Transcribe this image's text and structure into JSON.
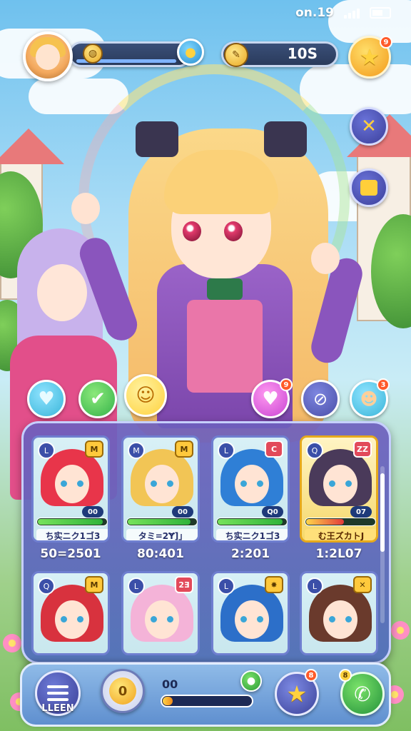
{
  "status_bar": {
    "time": "on.19"
  },
  "hud": {
    "avatar": "player-avatar",
    "left_bar_icon": "coin-icon",
    "left_bar_button_icon": "chick-icon",
    "currency_icon": "feather-icon",
    "currency_value": "10S",
    "star_button_badge": "9"
  },
  "side_buttons": [
    {
      "icon": "crossed-swords-icon"
    },
    {
      "icon": "bag-icon"
    }
  ],
  "quick_actions": [
    {
      "icon": "heart-icon",
      "color": "#3ab6d9"
    },
    {
      "icon": "check-icon",
      "color": "#35b34a"
    },
    {
      "icon": "smiley-star-icon",
      "color": "#ffd23f"
    },
    {
      "icon": "heart-gem-icon",
      "color": "#c944d3",
      "badge": "9"
    },
    {
      "icon": "no-phone-icon",
      "color": "#4a4fa8"
    },
    {
      "icon": "face-icon",
      "color": "#3ab6d9",
      "badge": "3"
    }
  ],
  "roster": [
    {
      "level": "L",
      "rank": "M",
      "number": "00",
      "name": "ち实ニク1ゴ3",
      "power": "50=2501",
      "hair": "#e8354a",
      "gold": false,
      "hp": 0.95
    },
    {
      "level": "M",
      "rank": "M",
      "number": "00",
      "name": "タミ=2Ɏ]」",
      "power": "80:401",
      "hair": "#f2c555",
      "gold": false,
      "hp": 0.92
    },
    {
      "level": "L",
      "rank": "C",
      "number": "Q0",
      "name": "ち实ニク1ゴ3",
      "power": "2:201",
      "hair": "#2f7fd6",
      "gold": false,
      "hp": 0.95
    },
    {
      "level": "Q",
      "rank": "ZZ",
      "number": "07",
      "name": "む王ズカトJ",
      "power": "1:2L07",
      "hair": "#4a3a5a",
      "gold": true,
      "hp": 0.55
    },
    {
      "level": "Q",
      "rank": "M",
      "hair": "#d8323e",
      "gold": false
    },
    {
      "level": "L",
      "rank": "2Ǝ",
      "hair": "#f4b3d8",
      "gold": false
    },
    {
      "level": "L",
      "rank": "✸",
      "hair": "#2c6fc9",
      "gold": false
    },
    {
      "level": "L",
      "rank": "✕",
      "hair": "#6a3a2c",
      "gold": false
    }
  ],
  "bottom_nav": {
    "menu_label": "LLEEN",
    "coin_glyph": "0",
    "xp_label": "00",
    "xp_progress": 0.05,
    "star_badge": "8",
    "green_badge": "8"
  }
}
